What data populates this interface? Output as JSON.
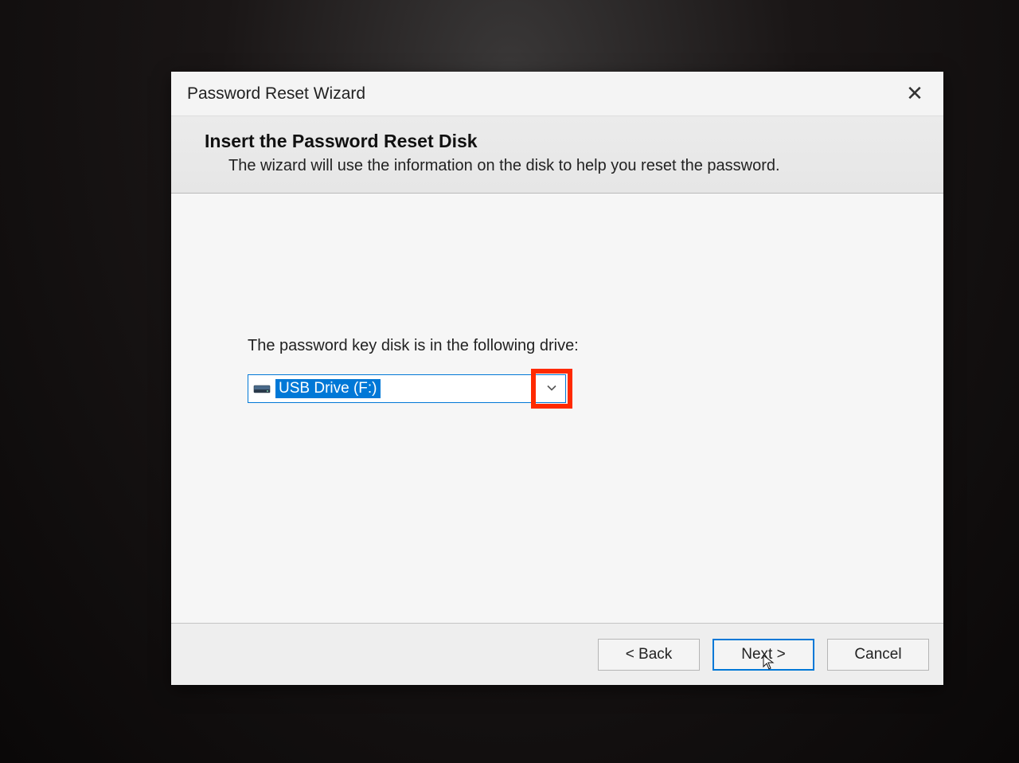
{
  "dialog": {
    "title": "Password Reset Wizard",
    "close_glyph": "✕"
  },
  "header": {
    "heading": "Insert the Password Reset Disk",
    "sub": "The wizard will use the information on the disk to help you reset the password."
  },
  "body": {
    "prompt": "The password key disk is in the following drive:",
    "combo": {
      "selected": "USB Drive (F:)",
      "chevron": "⌄"
    }
  },
  "footer": {
    "back": "< Back",
    "next": "Next >",
    "cancel": "Cancel"
  }
}
